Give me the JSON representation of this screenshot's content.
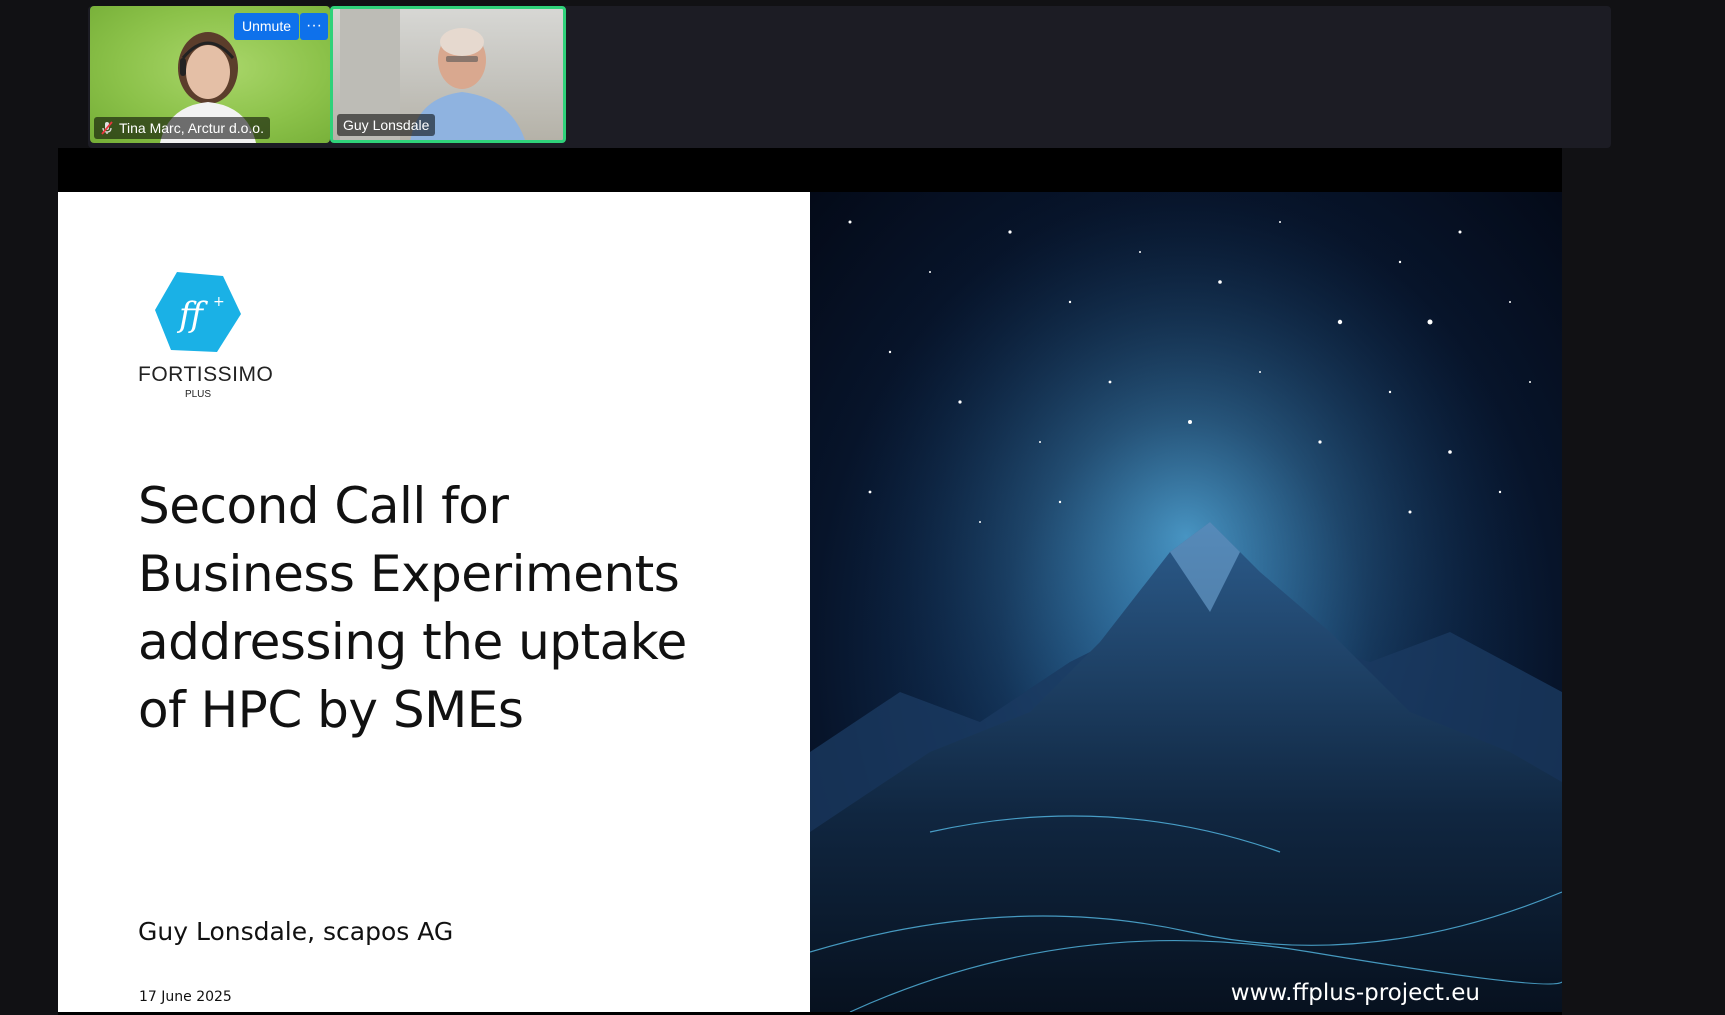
{
  "participants": [
    {
      "name": "Tina Marc, Arctur d.o.o.",
      "muted": true
    },
    {
      "name": "Guy Lonsdale",
      "active_speaker": true
    }
  ],
  "controls": {
    "unmute_label": "Unmute",
    "more_label": "···"
  },
  "slide": {
    "logo_text": "FORTISSIMO",
    "logo_sub": "PLUS",
    "title_lines": [
      "Second Call for",
      "Business Experiments",
      "addressing the uptake",
      "of HPC by SMEs"
    ],
    "presenter": "Guy Lonsdale, scapos AG",
    "date": "17 June 2025",
    "url": "www.ffplus-project.eu"
  },
  "colors": {
    "logo_cyan": "#1ab1e6",
    "active_border": "#2fd27a",
    "button_blue": "#0e71eb"
  }
}
